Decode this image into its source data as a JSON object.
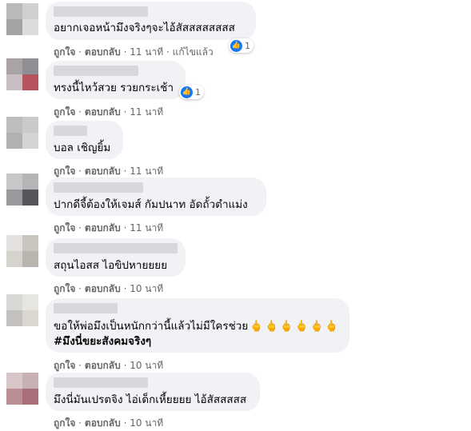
{
  "comments": [
    {
      "lines": [
        "อยากเจอหน้ามึงจริงๆจะไอ้สัสสสสสสสส"
      ],
      "reaction_count": "1",
      "like_label": "ถูกใจ",
      "reply_label": "ตอบกลับ",
      "time": "11 นาที",
      "edited": "แก้ไขแล้ว",
      "avatar_colors": [
        "#b9b9bb",
        "#cfcfd1",
        "#a3a3a6",
        "#dcdcde"
      ]
    },
    {
      "lines": [
        "ทรงนี้ไหว้สวย รวยกระเช้า"
      ],
      "reaction_count": "1",
      "like_label": "ถูกใจ",
      "reply_label": "ตอบกลับ",
      "time": "11 นาที",
      "avatar_colors": [
        "#a9a3a5",
        "#8f8e95",
        "#c9bfc2",
        "#b5545e"
      ]
    },
    {
      "lines": [
        "บอล เชิญยิ้ม"
      ],
      "like_label": "ถูกใจ",
      "reply_label": "ตอบกลับ",
      "time": "11 นาที",
      "avatar_colors": [
        "#bdbdbd",
        "#cacaca",
        "#b1b1b1",
        "#d4d4d4"
      ]
    },
    {
      "lines": [
        "ปากดีจี้ต้องให้เจมส์ กัมปนาท อัดถั้วตำแม่ง"
      ],
      "like_label": "ถูกใจ",
      "reply_label": "ตอบกลับ",
      "time": "11 นาที",
      "avatar_colors": [
        "#c8c8ca",
        "#b5b5b8",
        "#9a9a9e",
        "#55565c"
      ]
    },
    {
      "lines": [
        "สถุนไอสส ไอขิปหายยยย"
      ],
      "like_label": "ถูกใจ",
      "reply_label": "ตอบกลับ",
      "time": "10 นาที",
      "avatar_colors": [
        "#e3e1de",
        "#c9c6c0",
        "#d6d3cf",
        "#b9b5ae"
      ]
    },
    {
      "lines": [
        "ขอให้พ่อมึงเป็นหนักกว่านี้แล้วไม่มีใครช่วย",
        "#มึงนี่ขยะสังคมจริงๆ"
      ],
      "emojis": "🖕🖕🖕🖕🖕🖕",
      "like_label": "ถูกใจ",
      "reply_label": "ตอบกลับ",
      "time": "10 นาที",
      "avatar_colors": [
        "#d8d8d6",
        "#e6e5df",
        "#c2c1bd",
        "#dad8ce"
      ]
    },
    {
      "lines": [
        "มึงนี่มันเปรตจิง ไอ่เด็กเหี้ยยยย ไอ้สัสสสสส"
      ],
      "like_label": "ถูกใจ",
      "reply_label": "ตอบกลับ",
      "time": "10 นาที",
      "avatar_colors": [
        "#d8c6c8",
        "#c7b1b4",
        "#b98e94",
        "#a96f78"
      ]
    }
  ],
  "separator": "·",
  "like_icon": "thumbs-up-icon",
  "colors": {
    "bubble": "#f0f2f5",
    "meta": "#65676b",
    "like_blue": "#1877f2"
  }
}
